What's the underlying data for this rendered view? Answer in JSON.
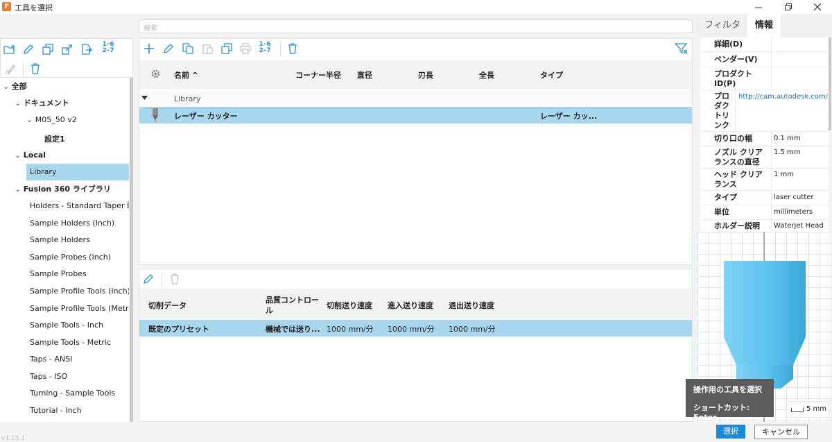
{
  "window": {
    "title": "工具を選択",
    "app_icon_letter": "F"
  },
  "search": {
    "placeholder": "検索"
  },
  "left_toolbar": {
    "renumber_label_top": "1–6",
    "renumber_label_bottom": "2–7"
  },
  "tree": {
    "items": [
      {
        "label": "全部",
        "chevron": "⌄"
      },
      {
        "label": "ドキュメント",
        "chevron": "⌄"
      },
      {
        "label": "M05_50 v2",
        "chevron": "⌄"
      },
      {
        "label": "設定1"
      },
      {
        "label": "Local",
        "chevron": "⌄"
      },
      {
        "label": "Library"
      },
      {
        "label": "Fusion 360 ライブラリ",
        "chevron": "⌄"
      },
      {
        "label": "Holders - Standard Taper Bla"
      },
      {
        "label": "Sample Holders (Inch)"
      },
      {
        "label": "Sample Holders"
      },
      {
        "label": "Sample Probes (Inch)"
      },
      {
        "label": "Sample Probes"
      },
      {
        "label": "Sample Profile Tools (Inch)"
      },
      {
        "label": "Sample Profile Tools (Metric)"
      },
      {
        "label": "Sample Tools - Inch"
      },
      {
        "label": "Sample Tools - Metric"
      },
      {
        "label": "Taps - ANSI"
      },
      {
        "label": "Taps - ISO"
      },
      {
        "label": "Turning - Sample Tools"
      },
      {
        "label": "Tutorial - Inch"
      }
    ]
  },
  "tool_table": {
    "renumber_label_top": "1–6",
    "renumber_label_bottom": "2–7",
    "columns": {
      "name": "名前 ^",
      "corner_radius": "コーナー半径",
      "diameter": "直径",
      "flute_length": "刃長",
      "overall_length": "全長",
      "type": "タイプ"
    },
    "group": {
      "name": "Library"
    },
    "rows": [
      {
        "name": "レーザー カッター",
        "type": "レーザー カッ..."
      }
    ]
  },
  "preset_table": {
    "columns": {
      "cut_data": "切削データ",
      "quality_control": "品質コントロー",
      "quality_control_2": "ル",
      "cutting_feed": "切削送り速度",
      "lead_in_feed": "進入送り速度",
      "lead_out_feed": "退出送り速度"
    },
    "rows": [
      {
        "name": "既定のプリセット",
        "quality": "機械では送り...",
        "cutting_feed": "1000 mm/分",
        "lead_in_feed": "1000 mm/分",
        "lead_out_feed": "1000 mm/分"
      }
    ]
  },
  "right_panel": {
    "tabs": [
      "フィルタ",
      "情報"
    ],
    "active_tab": "情報",
    "info": [
      {
        "key": "詳細(D)",
        "value": ""
      },
      {
        "key": "ベンダー(V)",
        "value": ""
      },
      {
        "key": "プロダクト ID(P)",
        "value": ""
      },
      {
        "key": "プロダクトリンク",
        "value": "http://cam.autodesk.com/"
      },
      {
        "key": "切り口の幅",
        "value": "0.1 mm"
      },
      {
        "key": "ノズル クリアランスの直径",
        "value": "1.5 mm"
      },
      {
        "key": "ヘッド クリアランス",
        "value": "1 mm"
      },
      {
        "key": "タイプ",
        "value": "laser cutter"
      },
      {
        "key": "単位",
        "value": "millimeters"
      },
      {
        "key": "ホルダー説明",
        "value": "Waterjet Head"
      }
    ],
    "scale_label": "5 mm"
  },
  "tooltip": {
    "title": "操作用の工具を選択",
    "shortcut": "ショートカット: Enter"
  },
  "buttons": {
    "select": "選択",
    "cancel": "キャンセル"
  },
  "status": {
    "version_text": "v1.15.1"
  },
  "colors": {
    "selection": "#a9d6ef",
    "accent": "#1c8ad8",
    "icon_blue": "#2b8fd3",
    "tool_preview": "#5cc3f0"
  }
}
